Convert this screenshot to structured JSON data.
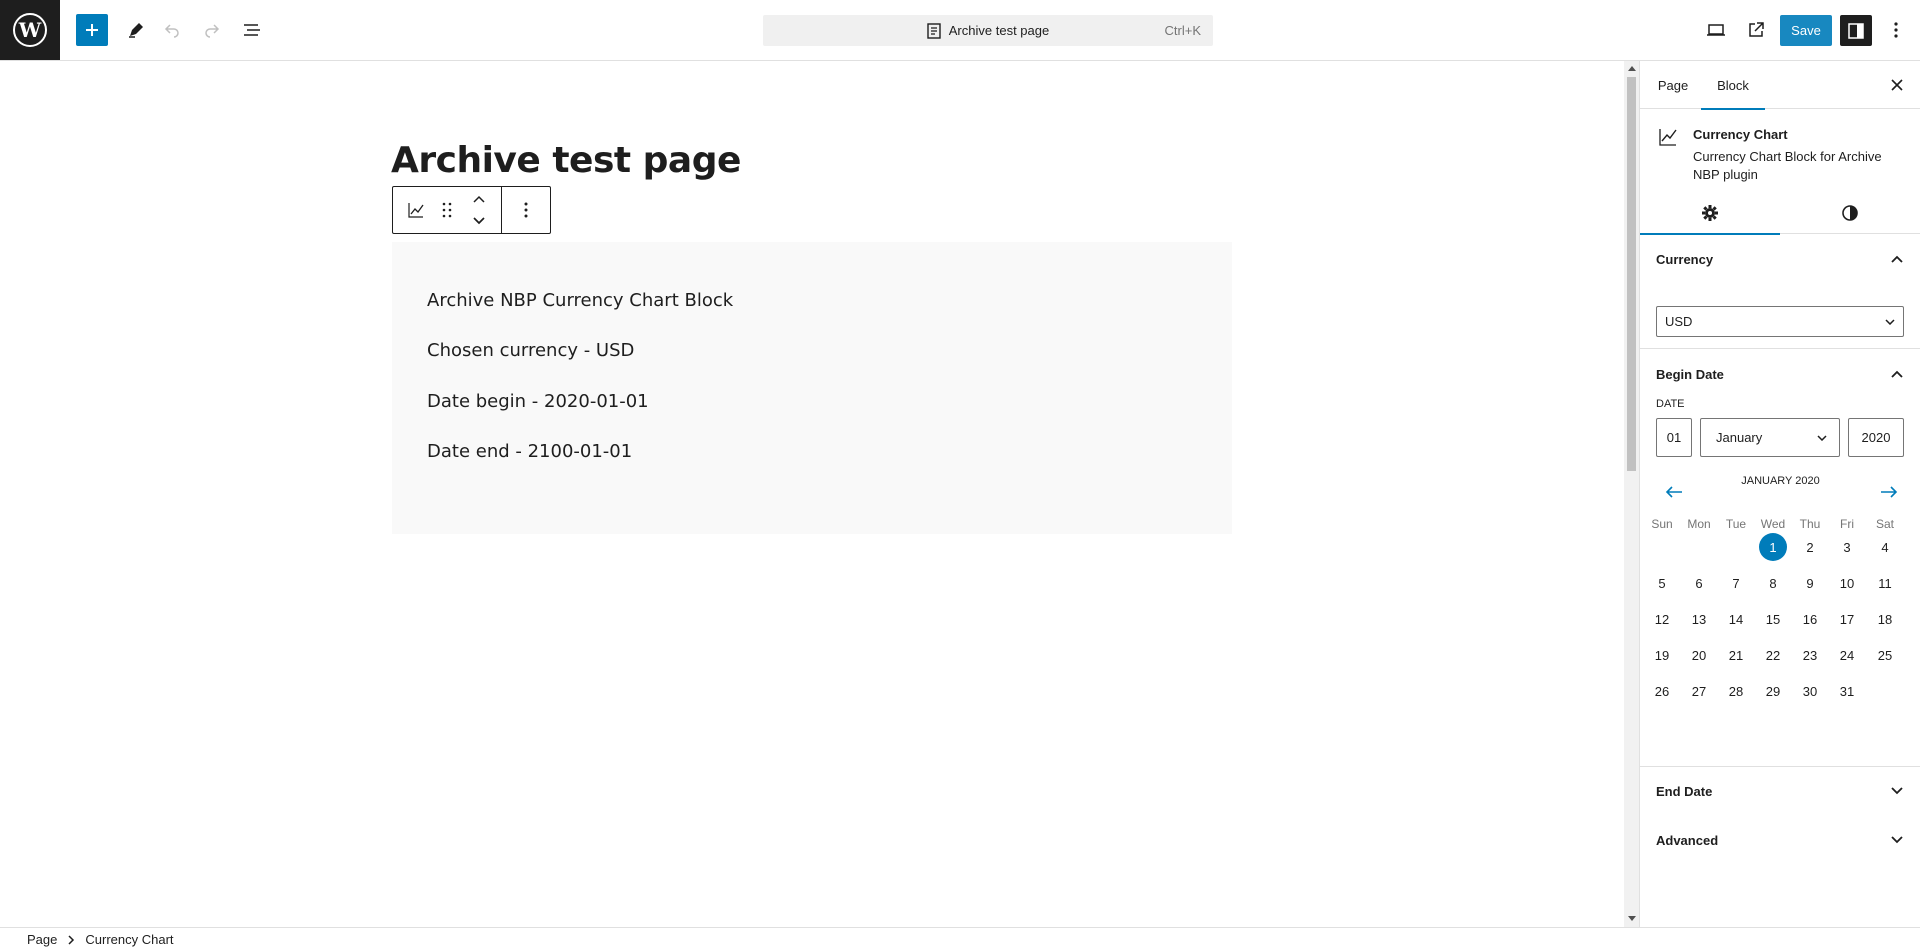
{
  "header": {
    "document_title": "Archive test page",
    "shortcut": "Ctrl+K",
    "save_label": "Save"
  },
  "post": {
    "title": "Archive test page",
    "block_lines": [
      "Archive NBP Currency Chart Block",
      "Chosen currency - USD",
      "Date begin - 2020-01-01",
      "Date end - 2100-01-01"
    ]
  },
  "sidebar": {
    "tabs": [
      "Page",
      "Block"
    ],
    "active_tab": "Block",
    "block_card": {
      "title": "Currency Chart",
      "description": "Currency Chart Block for Archive NBP plugin"
    },
    "panels": {
      "currency": {
        "title": "Currency",
        "selected": "USD"
      },
      "begin_date": {
        "title": "Begin Date",
        "date_label": "DATE",
        "day": "01",
        "month": "January",
        "year": "2020",
        "calendar": {
          "month_label": "JANUARY 2020",
          "weekdays": [
            "Sun",
            "Mon",
            "Tue",
            "Wed",
            "Thu",
            "Fri",
            "Sat"
          ],
          "days": [
            "1",
            "2",
            "3",
            "4",
            "5",
            "6",
            "7",
            "8",
            "9",
            "10",
            "11",
            "12",
            "13",
            "14",
            "15",
            "16",
            "17",
            "18",
            "19",
            "20",
            "21",
            "22",
            "23",
            "24",
            "25",
            "26",
            "27",
            "28",
            "29",
            "30",
            "31"
          ],
          "selected_day": "1"
        }
      },
      "end_date": {
        "title": "End Date"
      },
      "advanced": {
        "title": "Advanced"
      }
    }
  },
  "footer": {
    "breadcrumb": [
      "Page",
      "Currency Chart"
    ]
  },
  "colors": {
    "accent": "#007cba",
    "dark": "#1e1e1e"
  }
}
